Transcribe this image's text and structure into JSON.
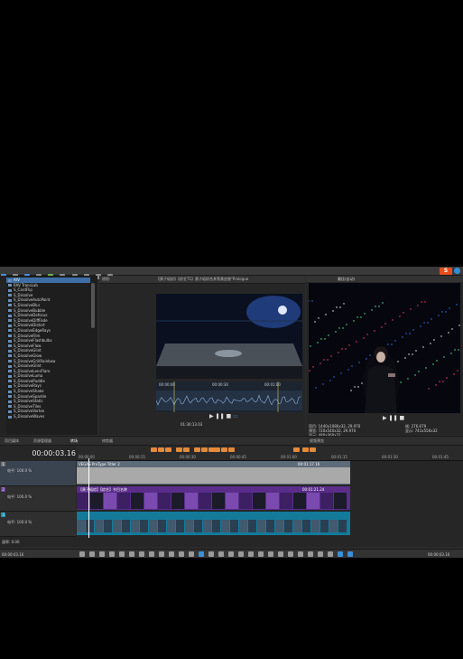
{
  "explorer": {
    "items": [
      "A/V",
      "RAV TransLab",
      "S_CardFlip",
      "S_Dissolve",
      "S_DissolveAutoPaint",
      "S_DissolveBlur",
      "S_DissolveBubble",
      "S_DissolveDefocus",
      "S_DissolveDiffFade",
      "S_DissolveDistort",
      "S_DissolveEdgeRays",
      "S_DissolveFilm",
      "S_DissolveFlashbulbs",
      "S_DissolveFlow",
      "S_DissolveGlint",
      "S_DissolveGlow",
      "S_DissolveGrillRainbow",
      "S_DissolveGlint",
      "S_DissolveLensFlare",
      "S_DissolveLuma",
      "S_DissolvePuddle",
      "S_DissolveRays",
      "S_DissolveShake",
      "S_DissolveSparkle",
      "S_DissolveStatic",
      "S_DissolveTiles",
      "S_DissolveVortex",
      "S_DissolveWaves"
    ],
    "selected_index": 0,
    "tabs": [
      "项目媒体",
      "资源管理器",
      "转场"
    ]
  },
  "trimmer": {
    "label": "修剪:"
  },
  "center": {
    "title": "【黄子韬综】【综艺T1】黄子韬综合其等黄逆袭\"Prologue",
    "timecode": "01:30:13.03",
    "ruler": [
      "00:00:00",
      "00:00:30",
      "00:01:00"
    ],
    "tab": "修剪器"
  },
  "right": {
    "title": "最佳(自动)",
    "info_left": [
      "项目: 1440x1080x32, 29.970",
      "预览: 720x540x32, 29.970",
      "显示: 480x360x32"
    ],
    "info_right": [
      "帧: 276,679",
      "显示: 741x556x32"
    ],
    "tab": "视频预览"
  },
  "timeline": {
    "timecode": "00:00:03.16",
    "ruler": [
      "00:00:00",
      "00:00:15",
      "00:00:30",
      "00:00:45",
      "00:01:00",
      "00:01:15",
      "00:01:30",
      "00:01:45"
    ],
    "track_levels": [
      "电平: 100.0 %",
      "电平: 100.0 %",
      "电平: 100.0 %"
    ],
    "track_numbers": [
      "1",
      "2",
      "3"
    ],
    "title_clip": "VEGAS ProType Titler 2",
    "video_clip": "【黄子韬综】【综艺】节目名称",
    "end_time1": "00:01:17.16",
    "end_time2": "00:01:21.24",
    "rate": "速率: 0.00"
  },
  "status": {
    "left": "00:00:03.16",
    "right": "00:00:03.16"
  },
  "colors": {
    "accent": "#3d6fa6",
    "marker": "#e38a3b",
    "title_track": "#6a7a8c",
    "video_track": "#6c3fa0",
    "audio_track": "#1a8fb0"
  }
}
